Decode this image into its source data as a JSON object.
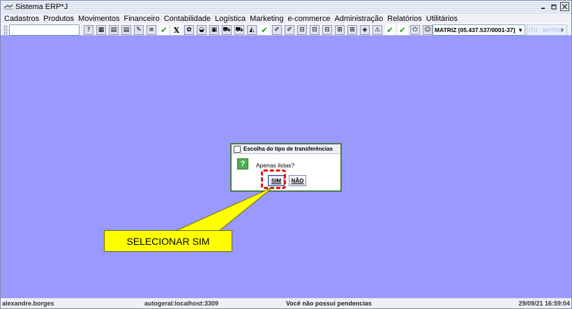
{
  "window": {
    "title": "Sistema ERP*J",
    "controls": [
      "minimize-icon",
      "maximize-icon",
      "close-icon"
    ]
  },
  "menu": {
    "items": [
      "Cadastros",
      "Produtos",
      "Movimentos",
      "Financeiro",
      "Contabilidade",
      "Logística",
      "Marketing",
      "e-commerce",
      "Administração",
      "Relatórios",
      "Utilitários"
    ]
  },
  "toolbar": {
    "search_value": "",
    "company_select": "MATRIZ [05.437.537/0001-37]",
    "branch_select": "ITU - MATRIZ"
  },
  "dialog": {
    "title": "Escolha do tipo de transferências",
    "question": "Apenas listas?",
    "yes_label": "SIM",
    "no_label": "NÃO"
  },
  "annotation": {
    "callout_text": "SELECIONAR SIM",
    "colors": {
      "callout_fill": "#ffff00",
      "highlight_border": "#e81010"
    }
  },
  "statusbar": {
    "user": "alexandre.borges",
    "server": "autogeral:localhost:3309",
    "pending": "Você não possui pendencias",
    "datetime": "29/09/21 16:59:04"
  },
  "colors": {
    "desktop": "#9999ff",
    "dialog_border": "#4a7a4a"
  }
}
